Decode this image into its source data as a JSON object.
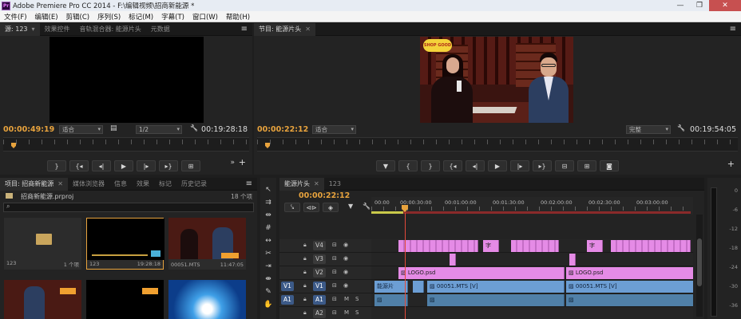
{
  "window": {
    "title": "Adobe Premiere Pro CC 2014 - F:\\编辑视频\\招商新能源 *",
    "app_icon": "Pr",
    "controls": [
      "—",
      "❐",
      "✕"
    ]
  },
  "menu": [
    "文件(F)",
    "编辑(E)",
    "剪辑(C)",
    "序列(S)",
    "标记(M)",
    "字幕(T)",
    "窗口(W)",
    "帮助(H)"
  ],
  "source_monitor": {
    "tabs": [
      "源: 123",
      "效果控件",
      "音轨混合器: 能源片头",
      "元数据"
    ],
    "timecode_left": "00:00:49:19",
    "fit": "适合",
    "resolution": "1/2",
    "timecode_right": "00:19:28:18"
  },
  "program_monitor": {
    "tab": "节目: 能源片头",
    "timecode_left": "00:00:22:12",
    "fit": "适合",
    "quality": "完整",
    "timecode_right": "00:19:54:05",
    "overlay_logo": "SHOP GOOD"
  },
  "project": {
    "tabs": [
      "项目: 招商新能源",
      "媒体浏览器",
      "信息",
      "效果",
      "标记",
      "历史记录"
    ],
    "file": "招商新能源.prproj",
    "count": "18 个项",
    "items": [
      {
        "name": "123",
        "info": "1 个项"
      },
      {
        "name": "123",
        "info": "19:28:18"
      },
      {
        "name": "00051.MTS",
        "info": "11:47:05"
      }
    ]
  },
  "timeline": {
    "tabs": [
      "能源片头",
      "123"
    ],
    "timecode": "00:00:22:12",
    "ruler": [
      "00:00",
      "00:00:30:00",
      "00:01:00:00",
      "00:01:30:00",
      "00:02:00:00",
      "00:02:30:00",
      "00:03:00:00"
    ],
    "tracks": [
      {
        "id": "V4",
        "src": ""
      },
      {
        "id": "V3",
        "src": ""
      },
      {
        "id": "V2",
        "src": ""
      },
      {
        "id": "V1",
        "src": "V1"
      },
      {
        "id": "A1",
        "src": "A1"
      },
      {
        "id": "A2",
        "src": ""
      }
    ],
    "clips": {
      "v4_text": "字",
      "logo": "LOGO.psd",
      "energy": "能源片",
      "mts": "00051.MTS [V]",
      "track_mute": "M",
      "track_solo": "S"
    }
  },
  "meter_scale": [
    "0",
    "-6",
    "-12",
    "-18",
    "-24",
    "-30",
    "-36"
  ],
  "icons": {
    "menu": "≡",
    "wrench": "🔧",
    "plus": "+",
    "play": "▶",
    "step_back": "◀|",
    "step_fwd": "|▶",
    "lock": "🔒",
    "eye": "👁",
    "mic": "🎤"
  }
}
